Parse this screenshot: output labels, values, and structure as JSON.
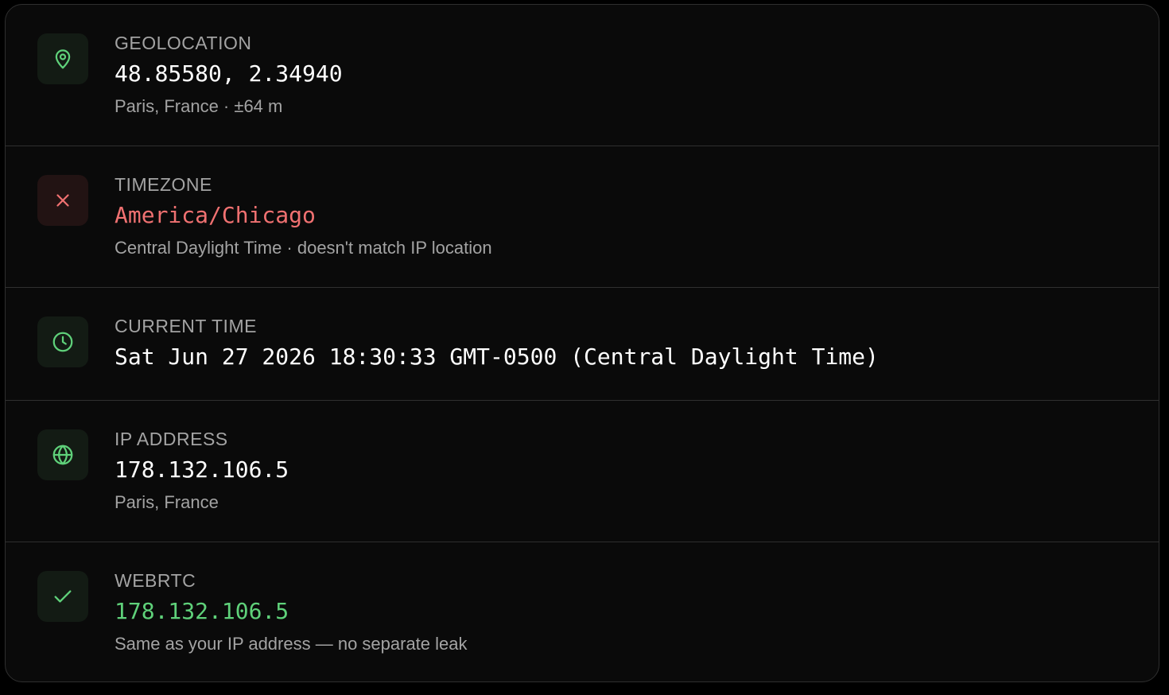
{
  "colors": {
    "ok_accent": "#5fd17a",
    "bad_accent": "#f07171",
    "icon_ok_bg": "#131b14",
    "icon_bad_bg": "#221313",
    "panel_bg": "#0a0a0a",
    "label_text": "#a3a3a3"
  },
  "rows": [
    {
      "icon": "map-pin-icon",
      "status": "ok",
      "label": "GEOLOCATION",
      "value": "48.85580, 2.34940",
      "sub": "Paris, France · ±64 m"
    },
    {
      "icon": "x-icon",
      "status": "bad",
      "label": "TIMEZONE",
      "value": "America/Chicago",
      "sub": "Central Daylight Time · doesn't match IP location"
    },
    {
      "icon": "clock-icon",
      "status": "ok",
      "label": "CURRENT TIME",
      "value": "Sat Jun 27 2026 18:30:33 GMT-0500 (Central Daylight Time)"
    },
    {
      "icon": "globe-icon",
      "status": "ok",
      "label": "IP ADDRESS",
      "value": "178.132.106.5",
      "sub": "Paris, France"
    },
    {
      "icon": "check-icon",
      "status": "ok",
      "label": "WEBRTC",
      "value": "178.132.106.5",
      "sub": "Same as your IP address — no separate leak"
    }
  ]
}
